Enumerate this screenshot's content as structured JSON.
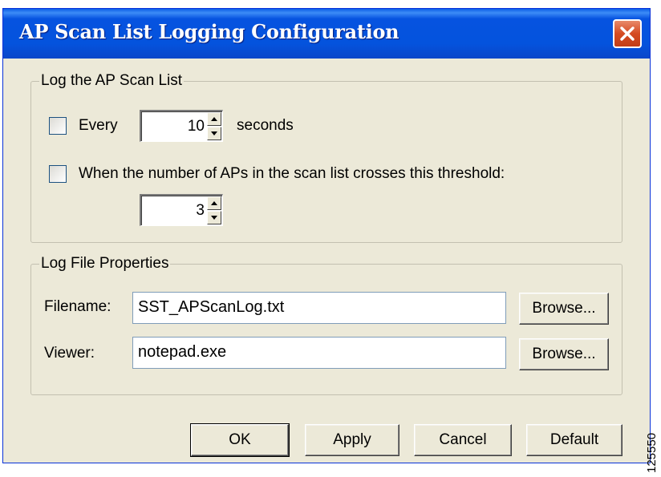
{
  "window": {
    "title": "AP Scan List Logging Configuration"
  },
  "log_group": {
    "legend": "Log the AP Scan List",
    "every_checkbox_label": "Every",
    "every_value": "10",
    "every_unit": "seconds",
    "threshold_checkbox_label": "When the number of APs in the scan list crosses this threshold:",
    "threshold_value": "3",
    "every_checked": false,
    "threshold_checked": false
  },
  "file_group": {
    "legend": "Log File Properties",
    "filename_label": "Filename:",
    "filename_value": "SST_APScanLog.txt",
    "viewer_label": "Viewer:",
    "viewer_value": "notepad.exe",
    "browse_label": "Browse..."
  },
  "buttons": {
    "ok": "OK",
    "apply": "Apply",
    "cancel": "Cancel",
    "default": "Default"
  },
  "watermark": "125550",
  "icons": [
    "close-icon",
    "spin-up-icon",
    "spin-down-icon"
  ],
  "colors": {
    "titlebar": "#0453dd",
    "close_button": "#d54b22",
    "dialog_bg": "#ece9d8"
  }
}
